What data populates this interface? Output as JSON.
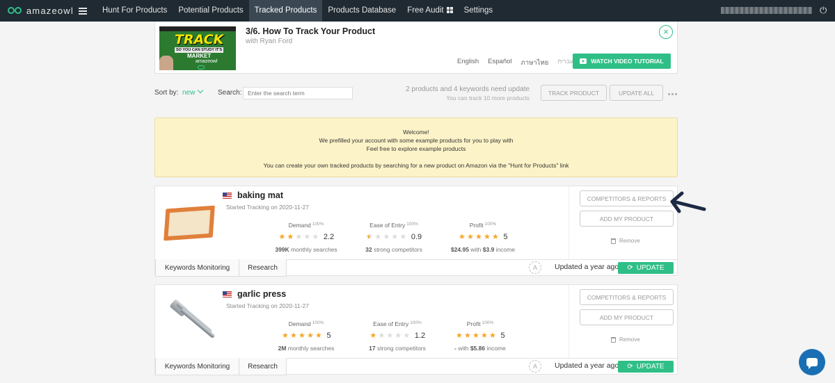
{
  "brand": "amazeowl",
  "nav": {
    "items": [
      {
        "label": "Hunt For Products"
      },
      {
        "label": "Potential Products"
      },
      {
        "label": "Tracked Products"
      },
      {
        "label": "Products Database"
      },
      {
        "label": "Free Audit"
      },
      {
        "label": "Settings"
      }
    ],
    "active": "Tracked Products"
  },
  "tutorial": {
    "thumb_big": "TRACK",
    "thumb_mid": "SO YOU CAN STUDY IT'S",
    "thumb_market": "MARKET",
    "thumb_brand": "amazeowl",
    "title": "3/6. How To Track Your Product",
    "subtitle": "with Ryan Ford",
    "languages": [
      "English",
      "Español",
      "ภาษาไทย",
      "עברית"
    ],
    "watch_label": "WATCH VIDEO TUTORIAL"
  },
  "toolbar": {
    "sort_label": "Sort by:",
    "sort_value": "new",
    "search_label": "Search:",
    "search_placeholder": "Enter the search term",
    "update_info": "2 products and 4 keywords need update",
    "track_more": "You can track 10 more products",
    "track_button": "TRACK PRODUCT",
    "update_all_button": "UPDATE ALL"
  },
  "welcome": {
    "line1": "Welcome!",
    "line2": "We prefilled your account with some example products for you to play with",
    "line3": "Feel free to explore example products",
    "line4": "You can create your own tracked products by searching for a new product on Amazon via the \"Hunt for Products\" link"
  },
  "products": [
    {
      "name": "baking mat",
      "started": "Started Tracking on 2020-11-27",
      "demand": {
        "title": "Demand",
        "pct": "100%",
        "stars": 2.2,
        "value": "2.2",
        "sub_bold": "399K",
        "sub": " monthly searches"
      },
      "ease": {
        "title": "Ease of Entry",
        "pct": "100%",
        "stars": 0.9,
        "value": "0.9",
        "sub_bold": "32",
        "sub": " strong competitors"
      },
      "profit": {
        "title": "Profit",
        "pct": "100%",
        "stars": 5,
        "value": "5",
        "sub_bold": "$24.95",
        "sub_mid": " with ",
        "sub_bold2": "$3.9",
        "sub_end": " income"
      },
      "tab_keywords": "Keywords Monitoring",
      "tab_research": "Research",
      "updated": "Updated a year ago",
      "update_button": "UPDATE",
      "competitors_button": "COMPETITORS & REPORTS",
      "add_button": "ADD MY PRODUCT",
      "remove": "Remove"
    },
    {
      "name": "garlic press",
      "started": "Started Tracking on 2020-11-27",
      "demand": {
        "title": "Demand",
        "pct": "100%",
        "stars": 5,
        "value": "5",
        "sub_bold": "2M",
        "sub": " monthly searches"
      },
      "ease": {
        "title": "Ease of Entry",
        "pct": "100%",
        "stars": 1.2,
        "value": "1.2",
        "sub_bold": "17",
        "sub": " strong competitors"
      },
      "profit": {
        "title": "Profit",
        "pct": "100%",
        "stars": 5,
        "value": "5",
        "sub_bold": "-",
        "sub_mid": " with ",
        "sub_bold2": "$5.86",
        "sub_end": " income"
      },
      "tab_keywords": "Keywords Monitoring",
      "tab_research": "Research",
      "updated": "Updated a year ago",
      "update_button": "UPDATE",
      "competitors_button": "COMPETITORS & REPORTS",
      "add_button": "ADD MY PRODUCT",
      "remove": "Remove"
    }
  ],
  "colors": {
    "nav_bg": "#1f2a32",
    "accent": "#2fbf86",
    "star": "#f5a623",
    "welcome_bg": "#fdf3c8",
    "arrow": "#1c2a44",
    "chat": "#1a6fb4"
  },
  "icons": [
    "owl-logo-icon",
    "hamburger-menu-icon",
    "qr-code-icon",
    "logout-icon",
    "close-circle-icon",
    "youtube-play-icon",
    "chevron-down-icon",
    "more-dots-icon",
    "us-flag-icon",
    "star-icon",
    "trash-icon",
    "auto-update-icon",
    "refresh-icon",
    "annotation-arrow-icon",
    "chat-icon"
  ]
}
